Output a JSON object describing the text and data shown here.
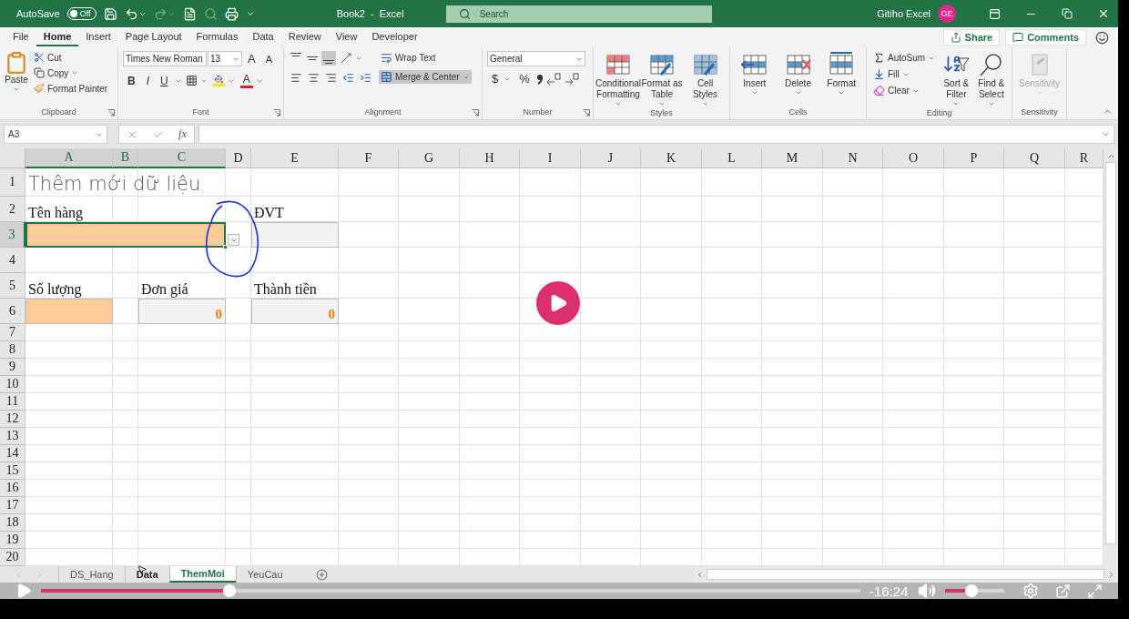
{
  "title_bar": {
    "autosave": "AutoSave",
    "autosave_switch": {
      "label": "Off",
      "on": false
    },
    "document_title": "Book2  -  Excel",
    "search": {
      "placeholder": "Search"
    },
    "account_name": "Gitiho Excel",
    "avatar_initials": "GE"
  },
  "menu_tabs": [
    {
      "label": "File",
      "selected": false
    },
    {
      "label": "Home",
      "selected": true
    },
    {
      "label": "Insert",
      "selected": false
    },
    {
      "label": "Page Layout",
      "selected": false
    },
    {
      "label": "Formulas",
      "selected": false
    },
    {
      "label": "Data",
      "selected": false
    },
    {
      "label": "Review",
      "selected": false
    },
    {
      "label": "View",
      "selected": false
    },
    {
      "label": "Developer",
      "selected": false
    }
  ],
  "share": "Share",
  "comments": "Comments",
  "ribbon": [
    {
      "kind": "clipboard",
      "name": "Clipboard",
      "paste": "Paste",
      "items": [
        "Cut",
        "Copy",
        "Format Painter"
      ]
    },
    {
      "kind": "font",
      "name": "Font",
      "font_name": "Times New Roman",
      "font_size": "13",
      "grow": "A",
      "shrink": "A",
      "styles": [
        "B",
        "I",
        "U"
      ],
      "font_color": "A"
    },
    {
      "kind": "alignment",
      "name": "Alignment",
      "vertical_align": [
        {
          "on": false
        },
        {
          "on": false
        },
        {
          "on": true
        }
      ],
      "wrap_text": "Wrap Text",
      "merge": {
        "label": "Merge & Center",
        "on": true
      }
    },
    {
      "kind": "number",
      "name": "Number",
      "format": "General",
      "currency": "$",
      "percent": "%"
    },
    {
      "kind": "big_buttons",
      "name": "Styles",
      "buttons": [
        {
          "kind": "conditional",
          "lines": [
            "Conditional",
            "Formatting"
          ],
          "disabled": false
        },
        {
          "kind": "table",
          "lines": [
            "Format as",
            "Table"
          ],
          "disabled": false
        },
        {
          "kind": "styles",
          "lines": [
            "Cell",
            "Styles"
          ],
          "disabled": false
        }
      ]
    },
    {
      "kind": "big_buttons",
      "name": "Cells",
      "buttons": [
        {
          "kind": "insert",
          "lines": [
            "Insert"
          ],
          "disabled": false
        },
        {
          "kind": "delete",
          "lines": [
            "Delete"
          ],
          "disabled": false
        },
        {
          "kind": "format",
          "lines": [
            "Format"
          ],
          "disabled": false
        }
      ]
    },
    {
      "kind": "editing",
      "name": "Editing",
      "autosum": "AutoSum",
      "fill": "Fill",
      "clear": "Clear",
      "buttons": [
        {
          "kind": "sort",
          "lines": [
            "Sort &",
            "Filter"
          ],
          "disabled": false
        },
        {
          "kind": "find",
          "lines": [
            "Find &",
            "Select"
          ],
          "disabled": false
        }
      ]
    },
    {
      "kind": "big_buttons",
      "name": "Sensitivity",
      "buttons": [
        {
          "kind": "sensitivity",
          "lines": [
            "Sensitivity"
          ],
          "disabled": true
        }
      ]
    }
  ],
  "formula_bar": {
    "name_box": "A3",
    "fx": "fx"
  },
  "columns": [
    {
      "label": "A",
      "selected": true
    },
    {
      "label": "B",
      "selected": true
    },
    {
      "label": "C",
      "selected": true
    },
    {
      "label": "D",
      "selected": false
    },
    {
      "label": "E",
      "selected": false
    },
    {
      "label": "F",
      "selected": false
    },
    {
      "label": "G",
      "selected": false
    },
    {
      "label": "H",
      "selected": false
    },
    {
      "label": "I",
      "selected": false
    },
    {
      "label": "J",
      "selected": false
    },
    {
      "label": "K",
      "selected": false
    },
    {
      "label": "L",
      "selected": false
    },
    {
      "label": "M",
      "selected": false
    },
    {
      "label": "N",
      "selected": false
    },
    {
      "label": "O",
      "selected": false
    },
    {
      "label": "P",
      "selected": false
    },
    {
      "label": "Q",
      "selected": false
    },
    {
      "label": "R",
      "selected": false
    }
  ],
  "rows": [
    {
      "label": "1",
      "selected": false,
      "cells": [
        {
          "kind": "title",
          "text": "Thêm mới dữ liệu"
        }
      ]
    },
    {
      "label": "2",
      "selected": false,
      "cells": [
        {
          "kind": "label",
          "text": "Tên hàng"
        },
        {
          "kind": "blank"
        },
        {
          "kind": "blank"
        },
        {
          "kind": "blank"
        },
        {
          "kind": "label",
          "text": "ĐVT"
        }
      ]
    },
    {
      "label": "3",
      "selected": true,
      "cells": [
        {
          "kind": "input_wide",
          "selected": true
        },
        {
          "kind": "dropdown"
        },
        {
          "kind": "readonly"
        }
      ]
    },
    {
      "label": "4",
      "selected": false
    },
    {
      "label": "5",
      "selected": false,
      "cells": [
        {
          "kind": "label",
          "text": "Số lượng"
        },
        {
          "kind": "blank"
        },
        {
          "kind": "label",
          "text": "Đơn giá"
        },
        {
          "kind": "blank"
        },
        {
          "kind": "label",
          "text": "Thành tiền"
        }
      ]
    },
    {
      "label": "6",
      "selected": false,
      "cells": [
        {
          "kind": "input"
        },
        {
          "kind": "blank"
        },
        {
          "kind": "value",
          "text": "0"
        },
        {
          "kind": "blank"
        },
        {
          "kind": "value",
          "text": "0"
        }
      ]
    },
    {
      "label": "7",
      "selected": false
    },
    {
      "label": "8",
      "selected": false
    },
    {
      "label": "9",
      "selected": false
    },
    {
      "label": "10",
      "selected": false
    },
    {
      "label": "11",
      "selected": false
    },
    {
      "label": "12",
      "selected": false
    },
    {
      "label": "13",
      "selected": false
    },
    {
      "label": "14",
      "selected": false
    },
    {
      "label": "15",
      "selected": false
    },
    {
      "label": "16",
      "selected": false
    },
    {
      "label": "17",
      "selected": false
    },
    {
      "label": "18",
      "selected": false
    },
    {
      "label": "19",
      "selected": false
    },
    {
      "label": "20",
      "selected": false
    }
  ],
  "sheet_tabs": [
    {
      "label": "DS_Hang",
      "selected": false,
      "hovered": false
    },
    {
      "label": "Data",
      "selected": false,
      "hovered": true
    },
    {
      "label": "ThemMoi",
      "selected": true,
      "hovered": false
    },
    {
      "label": "YeuCau",
      "selected": false,
      "hovered": false
    }
  ],
  "video": {
    "level": 0.23,
    "time": "-16:24",
    "volume": {
      "level": 0.45
    }
  }
}
